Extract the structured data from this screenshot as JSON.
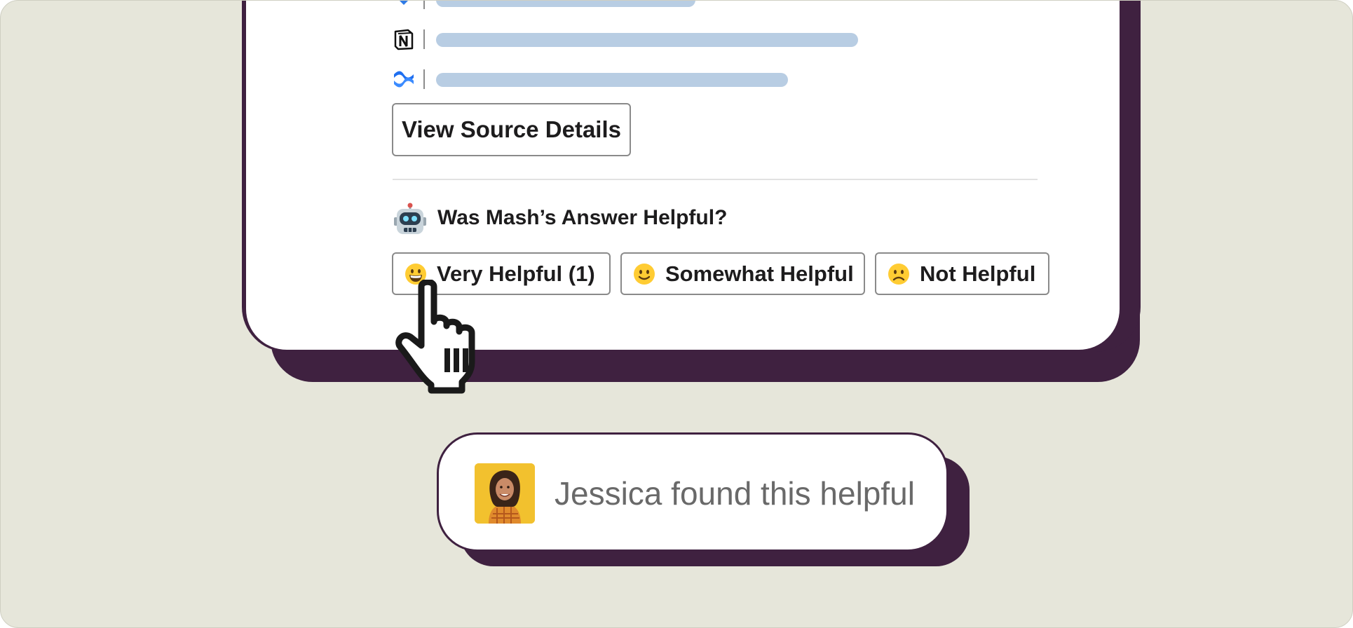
{
  "view_source_label": "View Source Details",
  "feedback": {
    "question": "Was Mash’s Answer Helpful?",
    "buttons": [
      {
        "label": "Very Helpful (1)",
        "icon": "grinning-face-icon"
      },
      {
        "label": "Somewhat Helpful",
        "icon": "slightly-smiling-face-icon"
      },
      {
        "label": "Not Helpful",
        "icon": "frowning-face-icon"
      }
    ]
  },
  "sources": [
    {
      "icon": "jira-icon"
    },
    {
      "icon": "notion-icon"
    },
    {
      "icon": "confluence-icon"
    }
  ],
  "toast": {
    "text": "Jessica found this helpful"
  },
  "colors": {
    "background": "#e6e6da",
    "card_frame": "#3f2140",
    "source_bar": "#b8cde3",
    "toast_text": "#696969"
  }
}
